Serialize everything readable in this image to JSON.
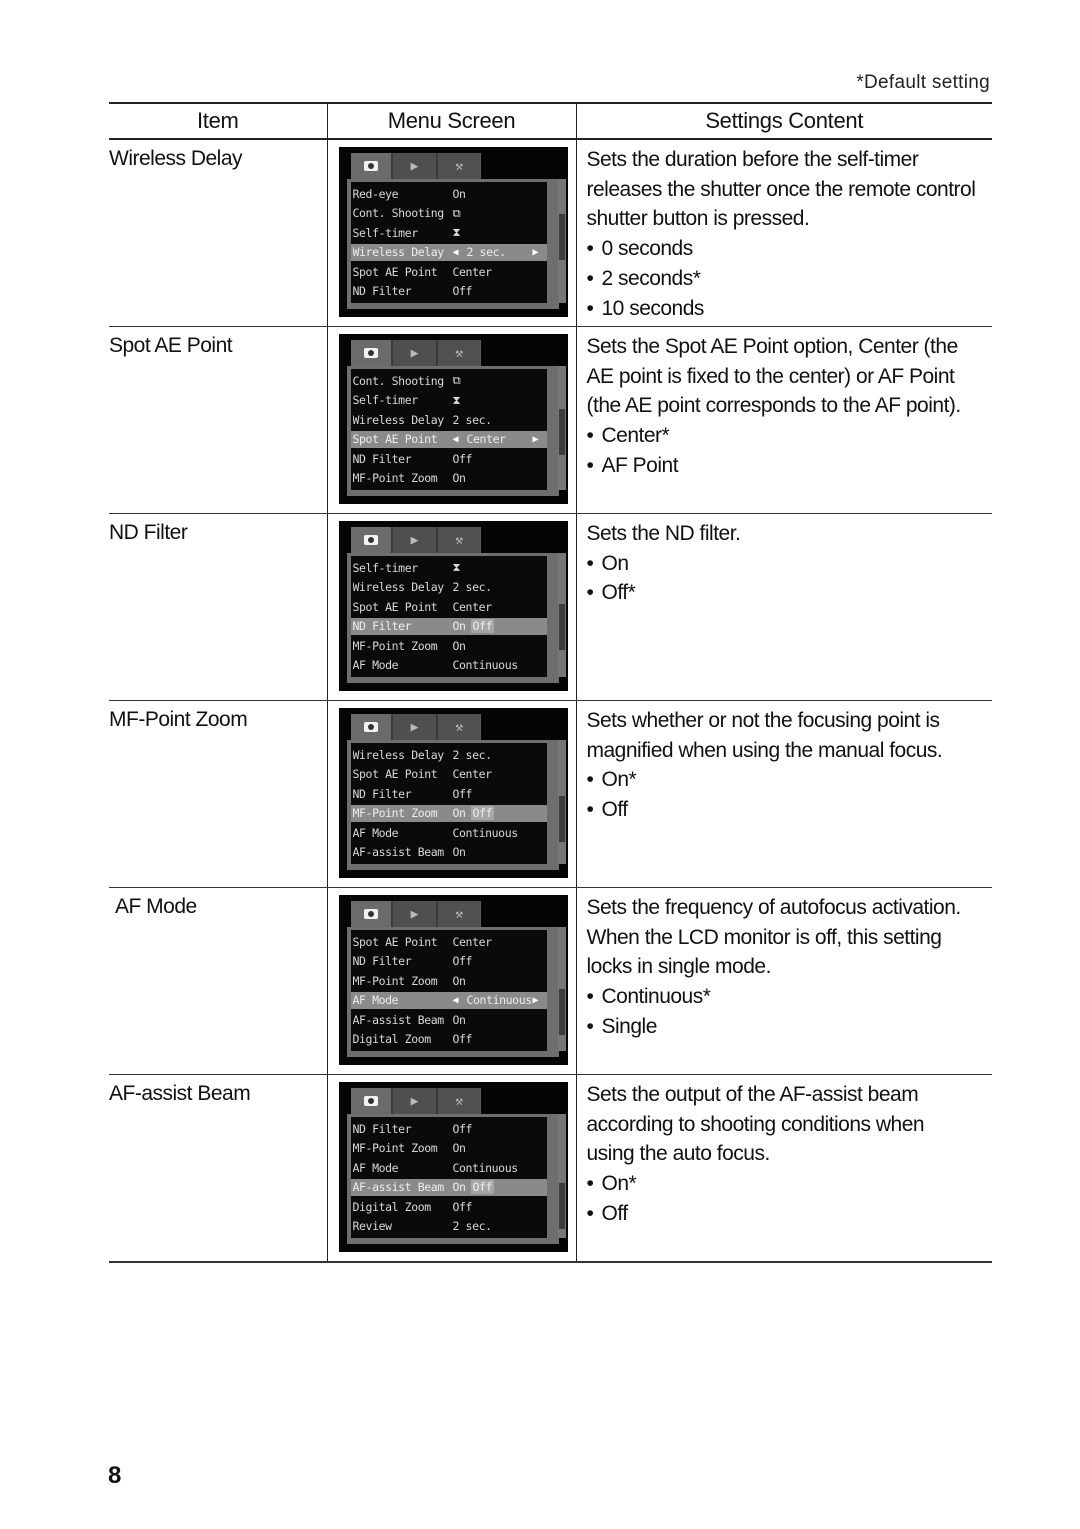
{
  "note": "*Default setting",
  "table": {
    "headers": [
      "Item",
      "Menu Screen",
      "Settings Content"
    ],
    "rows": [
      {
        "item": "Wireless Delay",
        "menu": {
          "tabs": [
            "camera-icon",
            "play-icon",
            "setup-icon"
          ],
          "rows": [
            {
              "label": "Red-eye",
              "value": "On"
            },
            {
              "label": "Cont. Shooting",
              "value": "⧉"
            },
            {
              "label": "Self-timer",
              "value": "⧗"
            },
            {
              "label": "Wireless Delay",
              "value": "2 sec.",
              "selected": true,
              "left_arrow": "◀",
              "right_arrow": "▶"
            },
            {
              "label": "Spot AE Point",
              "value": "Center"
            },
            {
              "label": "ND Filter",
              "value": "Off"
            }
          ],
          "scroll_position": 0.45
        },
        "description": [
          "Sets the duration before the self-timer",
          "releases the shutter once the remote control",
          "shutter button is pressed."
        ],
        "options": [
          "0 seconds",
          "2 seconds*",
          "10 seconds"
        ]
      },
      {
        "item": "Spot AE Point",
        "menu": {
          "tabs": [
            "camera-icon",
            "play-icon",
            "setup-icon"
          ],
          "rows": [
            {
              "label": "Cont. Shooting",
              "value": "⧉"
            },
            {
              "label": "Self-timer",
              "value": "⧗"
            },
            {
              "label": "Wireless Delay",
              "value": "2 sec."
            },
            {
              "label": "Spot AE Point",
              "value": "Center",
              "selected": true,
              "left_arrow": "◀",
              "right_arrow": "▶"
            },
            {
              "label": "ND Filter",
              "value": "Off"
            },
            {
              "label": "MF-Point Zoom",
              "value": "On"
            }
          ],
          "scroll_position": 0.55
        },
        "description": [
          "Sets the Spot AE Point option, Center (the",
          "AE point is fixed to the center) or AF Point",
          "(the AE point corresponds to the AF point)."
        ],
        "options": [
          "Center*",
          "AF Point"
        ]
      },
      {
        "item": "ND Filter",
        "menu": {
          "tabs": [
            "camera-icon",
            "play-icon",
            "setup-icon"
          ],
          "rows": [
            {
              "label": "Self-timer",
              "value": "⧗"
            },
            {
              "label": "Wireless Delay",
              "value": "2 sec."
            },
            {
              "label": "Spot AE Point",
              "value": "Center"
            },
            {
              "label": "ND Filter",
              "value": "On",
              "alt_value": "Off",
              "selected": true
            },
            {
              "label": "MF-Point Zoom",
              "value": "On"
            },
            {
              "label": "AF Mode",
              "value": "Continuous"
            }
          ],
          "scroll_position": 0.65
        },
        "description": [
          "Sets the ND filter."
        ],
        "options": [
          "On",
          "Off*"
        ]
      },
      {
        "item": "MF-Point Zoom",
        "menu": {
          "tabs": [
            "camera-icon",
            "play-icon",
            "setup-icon"
          ],
          "rows": [
            {
              "label": "Wireless Delay",
              "value": "2 sec."
            },
            {
              "label": "Spot AE Point",
              "value": "Center"
            },
            {
              "label": "ND Filter",
              "value": "Off"
            },
            {
              "label": "MF-Point Zoom",
              "value": "On",
              "alt_value": "Off",
              "selected": true
            },
            {
              "label": "AF Mode",
              "value": "Continuous"
            },
            {
              "label": "AF-assist Beam",
              "value": "On"
            }
          ],
          "scroll_position": 0.72
        },
        "description": [
          "Sets whether or not the focusing point is",
          "magnified when using the manual focus."
        ],
        "options": [
          "On*",
          "Off"
        ]
      },
      {
        "item": "AF Mode",
        "menu": {
          "tabs": [
            "camera-icon",
            "play-icon",
            "setup-icon"
          ],
          "rows": [
            {
              "label": "Spot AE Point",
              "value": "Center"
            },
            {
              "label": "ND Filter",
              "value": "Off"
            },
            {
              "label": "MF-Point Zoom",
              "value": "On"
            },
            {
              "label": "AF Mode",
              "value": "Continuous",
              "selected": true,
              "left_arrow": "◀",
              "right_arrow": "▶"
            },
            {
              "label": "AF-assist Beam",
              "value": "On"
            },
            {
              "label": "Digital Zoom",
              "value": "Off"
            }
          ],
          "scroll_position": 0.8
        },
        "description": [
          "Sets the frequency of autofocus activation.",
          "When the LCD monitor is off, this setting",
          "locks in single mode."
        ],
        "options": [
          "Continuous*",
          "Single"
        ]
      },
      {
        "item": "AF-assist Beam",
        "menu": {
          "tabs": [
            "camera-icon",
            "play-icon",
            "setup-icon"
          ],
          "rows": [
            {
              "label": "ND Filter",
              "value": "Off"
            },
            {
              "label": "MF-Point Zoom",
              "value": "On"
            },
            {
              "label": "AF Mode",
              "value": "Continuous"
            },
            {
              "label": "AF-assist Beam",
              "value": "On",
              "alt_value": "Off",
              "selected": true
            },
            {
              "label": "Digital Zoom",
              "value": "Off"
            },
            {
              "label": "Review",
              "value": "2 sec."
            }
          ],
          "scroll_position": 0.88
        },
        "description": [
          "Sets the output of the AF-assist beam",
          "according to shooting conditions when",
          "using the auto focus."
        ],
        "options": [
          "On*",
          "Off"
        ]
      }
    ]
  },
  "bullet": "•",
  "page_number": "8"
}
